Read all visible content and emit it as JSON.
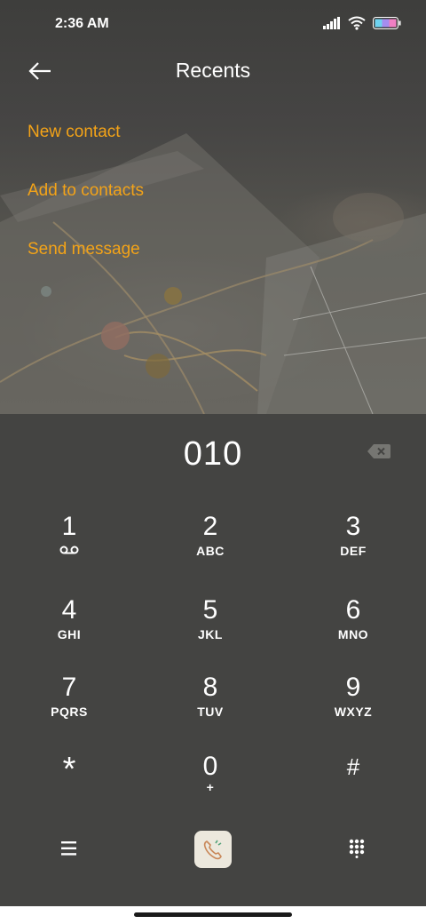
{
  "status_bar": {
    "time": "2:36 AM"
  },
  "header": {
    "title": "Recents"
  },
  "menu": {
    "new_contact": "New contact",
    "add_to_contacts": "Add to contacts",
    "send_message": "Send message"
  },
  "dialer": {
    "number": "010",
    "keys": [
      {
        "digit": "1",
        "letters": ""
      },
      {
        "digit": "2",
        "letters": "ABC"
      },
      {
        "digit": "3",
        "letters": "DEF"
      },
      {
        "digit": "4",
        "letters": "GHI"
      },
      {
        "digit": "5",
        "letters": "JKL"
      },
      {
        "digit": "6",
        "letters": "MNO"
      },
      {
        "digit": "7",
        "letters": "PQRS"
      },
      {
        "digit": "8",
        "letters": "TUV"
      },
      {
        "digit": "9",
        "letters": "WXYZ"
      },
      {
        "digit": "*",
        "letters": ""
      },
      {
        "digit": "0",
        "letters": "+"
      },
      {
        "digit": "#",
        "letters": ""
      }
    ]
  },
  "colors": {
    "accent": "#f3a318",
    "dialer_bg": "#444442",
    "call_button_bg": "#ece8dd"
  },
  "icons": {
    "back": "back-arrow-icon",
    "backspace": "backspace-icon",
    "voicemail": "voicemail-icon",
    "menu": "hamburger-menu-icon",
    "call": "phone-call-icon",
    "keypad": "dialpad-icon"
  }
}
